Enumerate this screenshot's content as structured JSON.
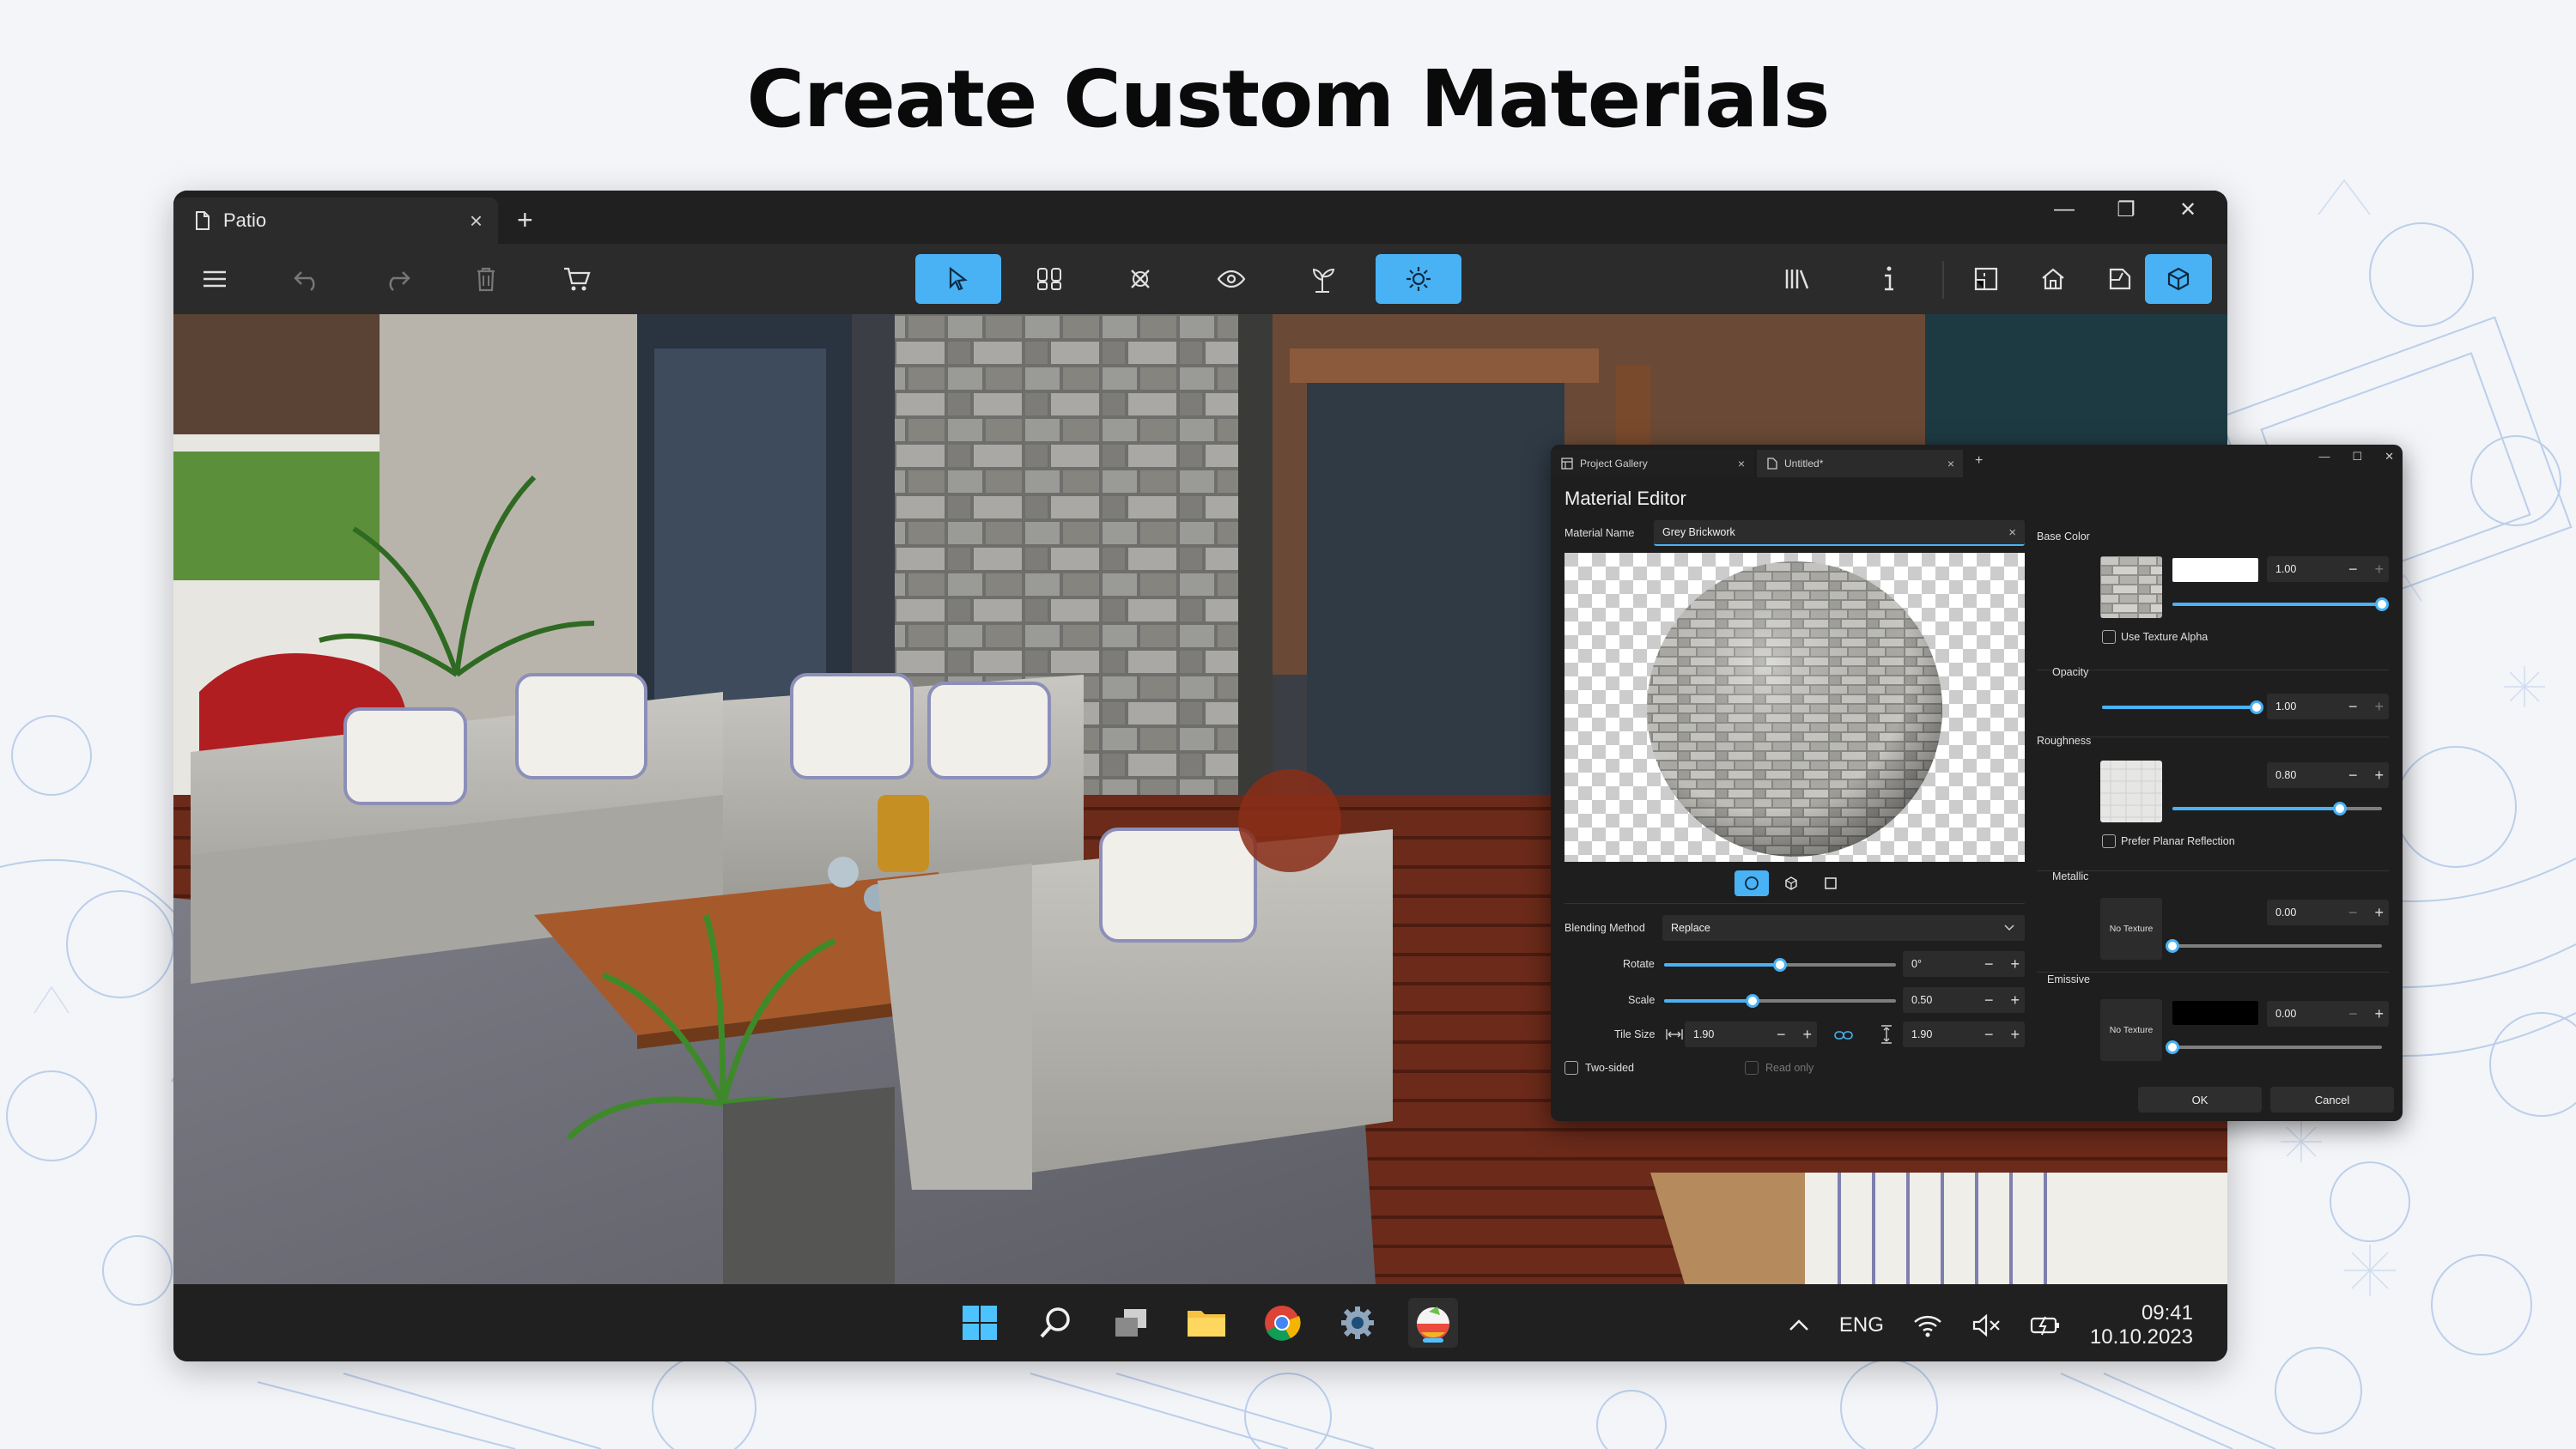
{
  "headline": "Create Custom Materials",
  "window": {
    "tab_title": "Patio",
    "tab_close": "×",
    "tab_add": "+",
    "controls": {
      "minimize": "—",
      "restore": "❐",
      "close": "✕"
    }
  },
  "material_editor": {
    "tabs": [
      {
        "label": "Project Gallery",
        "close": "×"
      },
      {
        "label": "Untitled*",
        "close": "×"
      }
    ],
    "tab_add": "+",
    "controls": {
      "minimize": "—",
      "restore": "☐",
      "close": "✕"
    },
    "title": "Material Editor",
    "material_name_label": "Material Name",
    "material_name_value": "Grey Brickwork",
    "clear": "×",
    "blending_method_label": "Blending Method",
    "blending_method_value": "Replace",
    "rotate_label": "Rotate",
    "rotate_value": "0°",
    "rotate_fraction": 0.5,
    "scale_label": "Scale",
    "scale_value": "0.50",
    "scale_fraction": 0.38,
    "tile_size_label": "Tile Size",
    "tile_width": "1.90",
    "tile_height": "1.90",
    "two_sided_label": "Two-sided",
    "read_only_label": "Read only",
    "base_color_label": "Base Color",
    "base_color_value": "1.00",
    "base_color_fraction": 1.0,
    "base_color_swatch": "#ffffff",
    "use_texture_alpha_label": "Use Texture Alpha",
    "opacity_label": "Opacity",
    "opacity_value": "1.00",
    "opacity_fraction": 1.0,
    "roughness_label": "Roughness",
    "roughness_value": "0.80",
    "roughness_fraction": 0.8,
    "prefer_planar_label": "Prefer Planar Reflection",
    "metallic_label": "Metallic",
    "metallic_no_texture": "No Texture",
    "metallic_value": "0.00",
    "metallic_fraction": 0.0,
    "emissive_label": "Emissive",
    "emissive_no_texture": "No Texture",
    "emissive_value": "0.00",
    "emissive_fraction": 0.0,
    "emissive_swatch": "#000000",
    "minus": "−",
    "plus": "+",
    "ok_label": "OK",
    "cancel_label": "Cancel"
  },
  "taskbar": {
    "language": "ENG",
    "time": "09:41",
    "date": "10.10.2023"
  },
  "colors": {
    "accent": "#49b2f5",
    "window_bg": "#1f1f1f",
    "toolbar_bg": "#2b2b2b"
  }
}
